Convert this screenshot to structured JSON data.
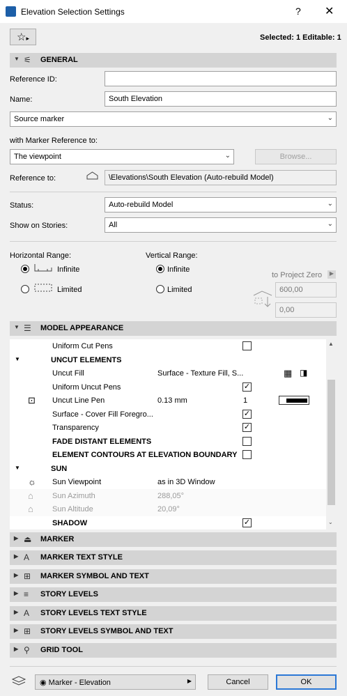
{
  "window": {
    "title": "Elevation Selection Settings",
    "help_glyph": "?",
    "close_glyph": "✕"
  },
  "top": {
    "selected_text": "Selected: 1 Editable: 1",
    "favorites_glyph": "☆",
    "arrow": "▸"
  },
  "sections": {
    "general": "GENERAL",
    "model_appearance": "MODEL APPEARANCE",
    "marker": "MARKER",
    "marker_text_style": "MARKER TEXT STYLE",
    "marker_symbol_text": "MARKER SYMBOL AND TEXT",
    "story_levels": "STORY LEVELS",
    "story_levels_text_style": "STORY LEVELS TEXT STYLE",
    "story_levels_symbol_text": "STORY LEVELS SYMBOL AND TEXT",
    "grid_tool": "GRID TOOL"
  },
  "general": {
    "reference_id_label": "Reference ID:",
    "reference_id_value": "",
    "name_label": "Name:",
    "name_value": "South Elevation",
    "source_marker": "Source marker",
    "with_marker_ref_label": "with Marker Reference to:",
    "viewpoint": "The viewpoint",
    "browse": "Browse...",
    "reference_to_label": "Reference to:",
    "reference_to_value": "\\Elevations\\South Elevation (Auto-rebuild Model)",
    "status_label": "Status:",
    "status_value": "Auto-rebuild Model",
    "show_on_stories_label": "Show on Stories:",
    "show_on_stories_value": "All",
    "horizontal_range_label": "Horizontal Range:",
    "vertical_range_label": "Vertical Range:",
    "infinite": "Infinite",
    "limited": "Limited",
    "to_project_zero": "to Project Zero",
    "top_value": "600,00",
    "bottom_value": "0,00"
  },
  "tree": [
    {
      "label": "Uniform Cut Pens",
      "value": "",
      "extra": "",
      "checkbox": "unchecked",
      "bold": false,
      "muted": false
    },
    {
      "label": "UNCUT ELEMENTS",
      "value": "",
      "extra": "",
      "checkbox": "none",
      "bold": true,
      "muted": false,
      "group": true
    },
    {
      "label": "Uncut Fill",
      "value": "Surface - Texture Fill, S...",
      "extra": "",
      "checkbox": "none",
      "bold": false,
      "muted": false
    },
    {
      "label": "Uniform Uncut Pens",
      "value": "",
      "extra": "",
      "checkbox": "checked",
      "bold": false,
      "muted": false
    },
    {
      "label": "Uncut Line Pen",
      "value": "0.13 mm",
      "extra": "1",
      "checkbox": "none",
      "bold": false,
      "muted": false
    },
    {
      "label": "Surface - Cover Fill Foregro...",
      "value": "",
      "extra": "",
      "checkbox": "checked",
      "bold": false,
      "muted": false
    },
    {
      "label": "Transparency",
      "value": "",
      "extra": "",
      "checkbox": "checked",
      "bold": false,
      "muted": false
    },
    {
      "label": "FADE DISTANT ELEMENTS",
      "value": "",
      "extra": "",
      "checkbox": "unchecked",
      "bold": true,
      "muted": false
    },
    {
      "label": "ELEMENT CONTOURS AT ELEVATION BOUNDARY",
      "value": "",
      "extra": "",
      "checkbox": "unchecked",
      "bold": true,
      "muted": false
    },
    {
      "label": "SUN",
      "value": "",
      "extra": "",
      "checkbox": "none",
      "bold": true,
      "muted": false,
      "group": true
    },
    {
      "label": "Sun Viewpoint",
      "value": "as in 3D Window",
      "extra": "",
      "checkbox": "none",
      "bold": false,
      "muted": false
    },
    {
      "label": "Sun Azimuth",
      "value": "288,05°",
      "extra": "",
      "checkbox": "none",
      "bold": false,
      "muted": true
    },
    {
      "label": "Sun Altitude",
      "value": "20,09°",
      "extra": "",
      "checkbox": "none",
      "bold": false,
      "muted": true
    },
    {
      "label": "SHADOW",
      "value": "",
      "extra": "",
      "checkbox": "checked",
      "bold": true,
      "muted": false
    }
  ],
  "footer": {
    "marker_dropdown": "Marker - Elevation",
    "cancel": "Cancel",
    "ok": "OK"
  },
  "colors": {
    "accent": "#2b78d6",
    "section_bg": "#d4d4d4",
    "app_icon": "#1d5fa8"
  }
}
